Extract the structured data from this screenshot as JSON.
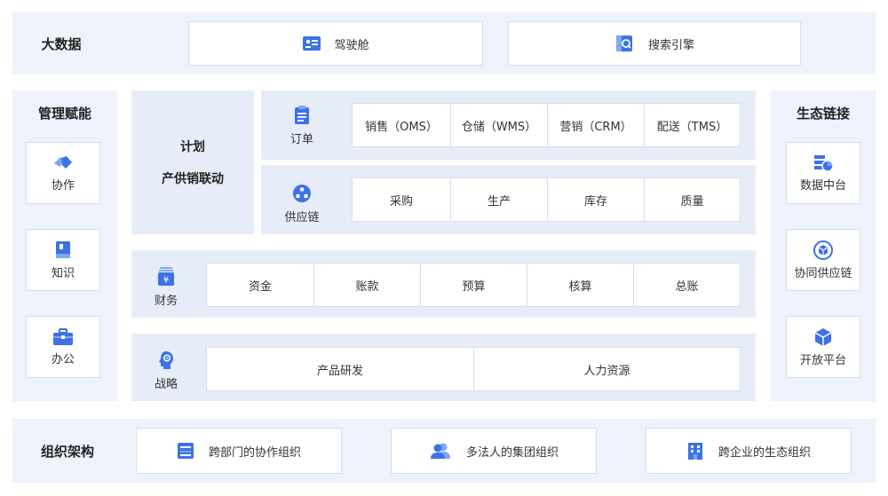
{
  "top": {
    "title": "大数据",
    "items": [
      {
        "label": "驾驶舱",
        "icon": "dashboard-icon"
      },
      {
        "label": "搜索引擎",
        "icon": "search-engine-icon"
      }
    ]
  },
  "left": {
    "title": "管理赋能",
    "items": [
      {
        "label": "协作",
        "icon": "handshake-icon"
      },
      {
        "label": "知识",
        "icon": "book-icon"
      },
      {
        "label": "办公",
        "icon": "briefcase-icon"
      }
    ]
  },
  "plan": {
    "line1": "计划",
    "line2": "产供销联动"
  },
  "order": {
    "label": "订单",
    "icon": "clipboard-icon",
    "cells": [
      "销售（OMS）",
      "仓储（WMS）",
      "营销（CRM）",
      "配送（TMS）"
    ]
  },
  "supply": {
    "label": "供应链",
    "icon": "network-icon",
    "cells": [
      "采购",
      "生产",
      "库存",
      "质量"
    ]
  },
  "finance": {
    "label": "财务",
    "icon": "yuan-box-icon",
    "cells": [
      "资金",
      "账款",
      "预算",
      "核算",
      "总账"
    ]
  },
  "strategy": {
    "label": "战略",
    "icon": "head-gear-icon",
    "cells": [
      "产品研发",
      "人力资源"
    ]
  },
  "right": {
    "title": "生态链接",
    "items": [
      {
        "label": "数据中台",
        "icon": "data-platform-icon"
      },
      {
        "label": "协同供应链",
        "icon": "cube-circle-icon"
      },
      {
        "label": "开放平台",
        "icon": "cube-icon"
      }
    ]
  },
  "bottom": {
    "title": "组织架构",
    "items": [
      {
        "label": "跨部门的协作组织",
        "icon": "org-card-icon"
      },
      {
        "label": "多法人的集团组织",
        "icon": "people-icon"
      },
      {
        "label": "跨企业的生态组织",
        "icon": "building-icon"
      }
    ]
  },
  "colors": {
    "accent": "#3d72e6",
    "accent_light": "#7ea7f5",
    "band": "#edf2fb",
    "panel": "#e7edf8",
    "border": "#d6deec"
  }
}
